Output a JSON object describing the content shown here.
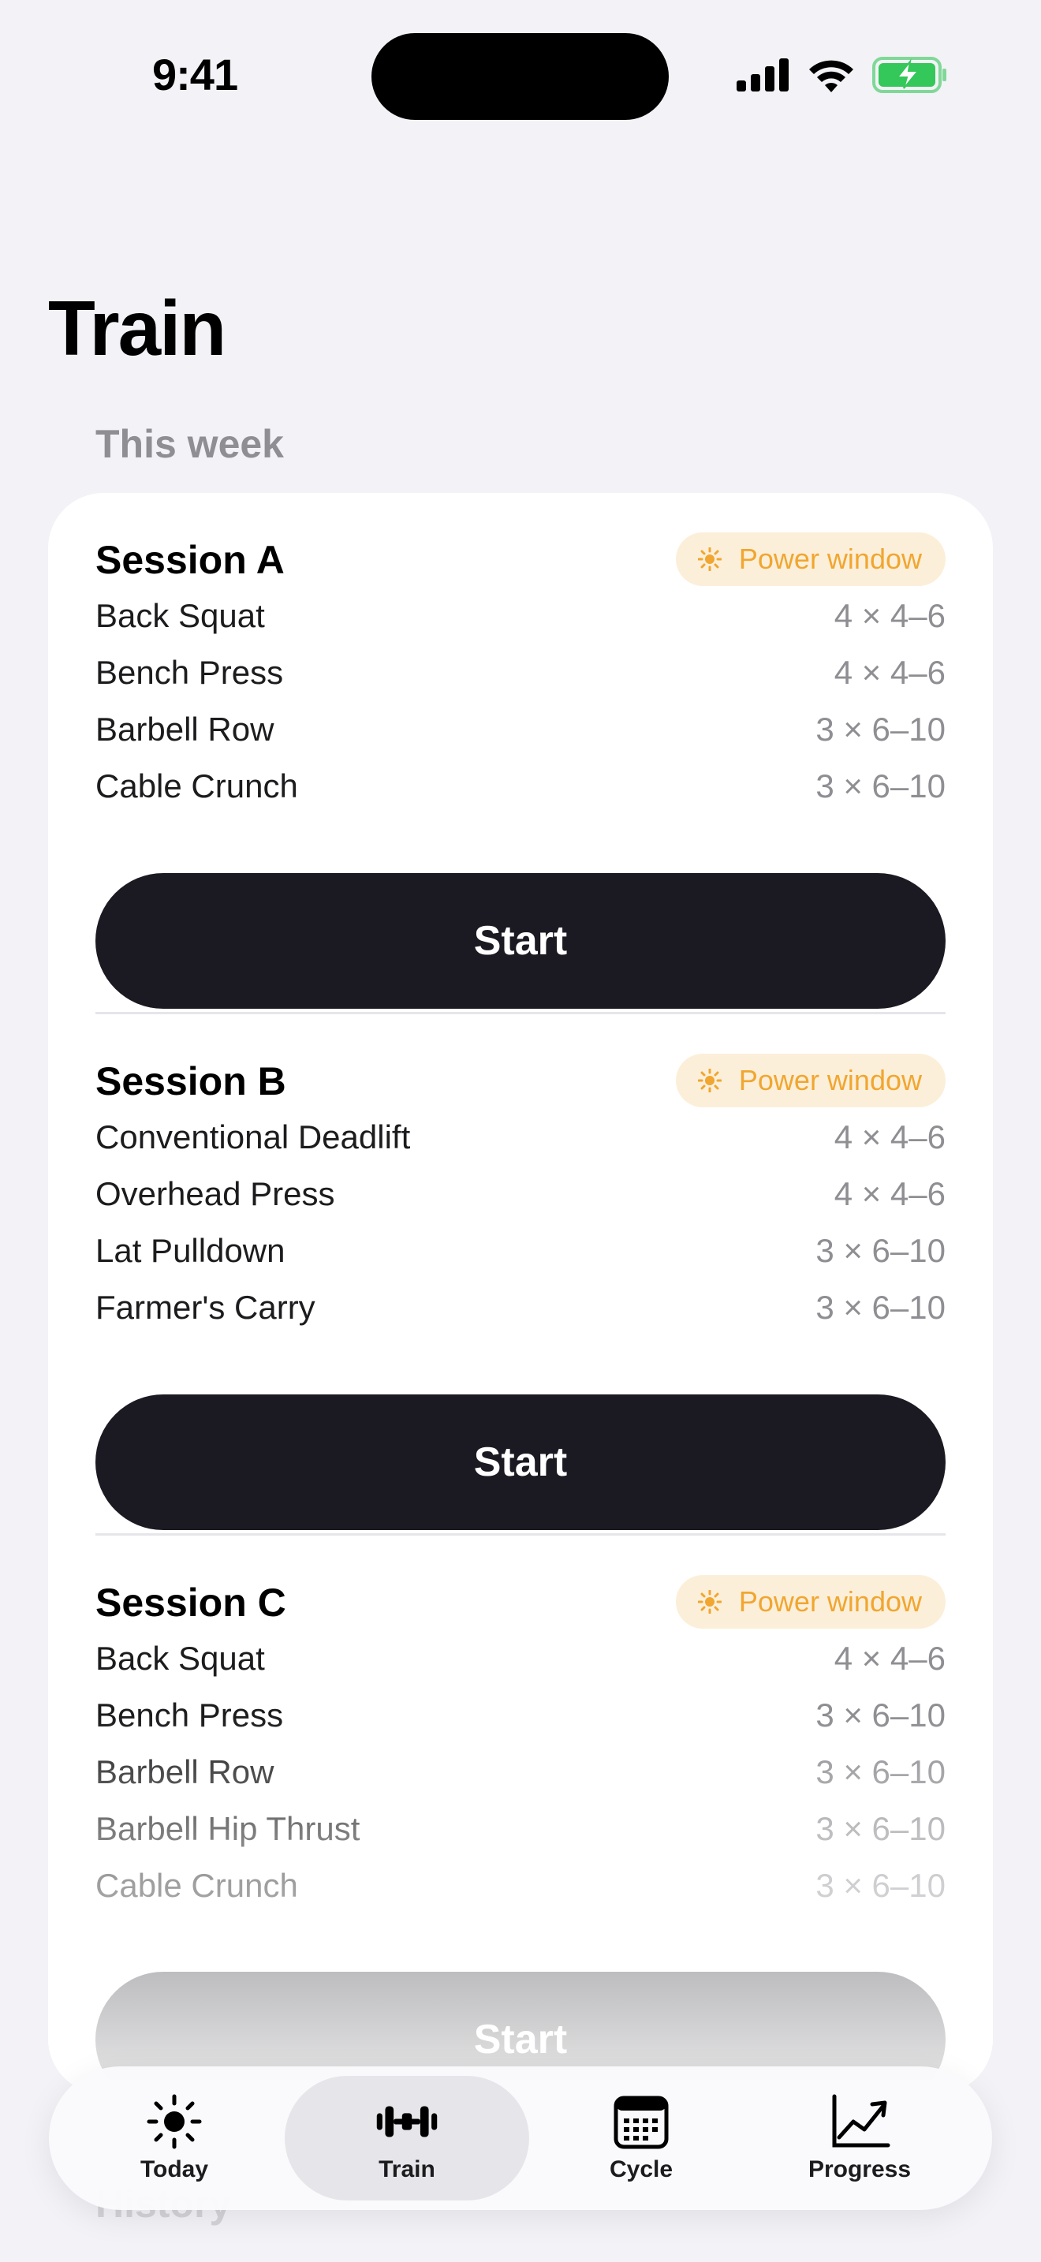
{
  "status_bar": {
    "time": "9:41"
  },
  "page": {
    "title": "Train",
    "section": "This week",
    "next_section": "History"
  },
  "sessions": [
    {
      "title": "Session A",
      "badge": "Power window",
      "exercises": [
        {
          "name": "Back Squat",
          "sets": "4 × 4–6"
        },
        {
          "name": "Bench Press",
          "sets": "4 × 4–6"
        },
        {
          "name": "Barbell Row",
          "sets": "3 × 6–10"
        },
        {
          "name": "Cable Crunch",
          "sets": "3 × 6–10"
        }
      ],
      "button": "Start"
    },
    {
      "title": "Session B",
      "badge": "Power window",
      "exercises": [
        {
          "name": "Conventional Deadlift",
          "sets": "4 × 4–6"
        },
        {
          "name": "Overhead Press",
          "sets": "4 × 4–6"
        },
        {
          "name": "Lat Pulldown",
          "sets": "3 × 6–10"
        },
        {
          "name": "Farmer's Carry",
          "sets": "3 × 6–10"
        }
      ],
      "button": "Start"
    },
    {
      "title": "Session C",
      "badge": "Power window",
      "exercises": [
        {
          "name": "Back Squat",
          "sets": "4 × 4–6"
        },
        {
          "name": "Bench Press",
          "sets": "3 × 6–10"
        },
        {
          "name": "Barbell Row",
          "sets": "3 × 6–10"
        },
        {
          "name": "Barbell Hip Thrust",
          "sets": "3 × 6–10"
        },
        {
          "name": "Cable Crunch",
          "sets": "3 × 6–10"
        }
      ],
      "button": "Start"
    }
  ],
  "tabs": [
    {
      "label": "Today",
      "icon": "sun-icon",
      "active": false
    },
    {
      "label": "Train",
      "icon": "dumbbell-icon",
      "active": true
    },
    {
      "label": "Cycle",
      "icon": "calendar-icon",
      "active": false
    },
    {
      "label": "Progress",
      "icon": "chart-line-icon",
      "active": false
    }
  ],
  "colors": {
    "accent": "#f0a630",
    "badge_bg": "#fcefd9",
    "button": "#1b1a22",
    "background": "#f2f2f7"
  }
}
